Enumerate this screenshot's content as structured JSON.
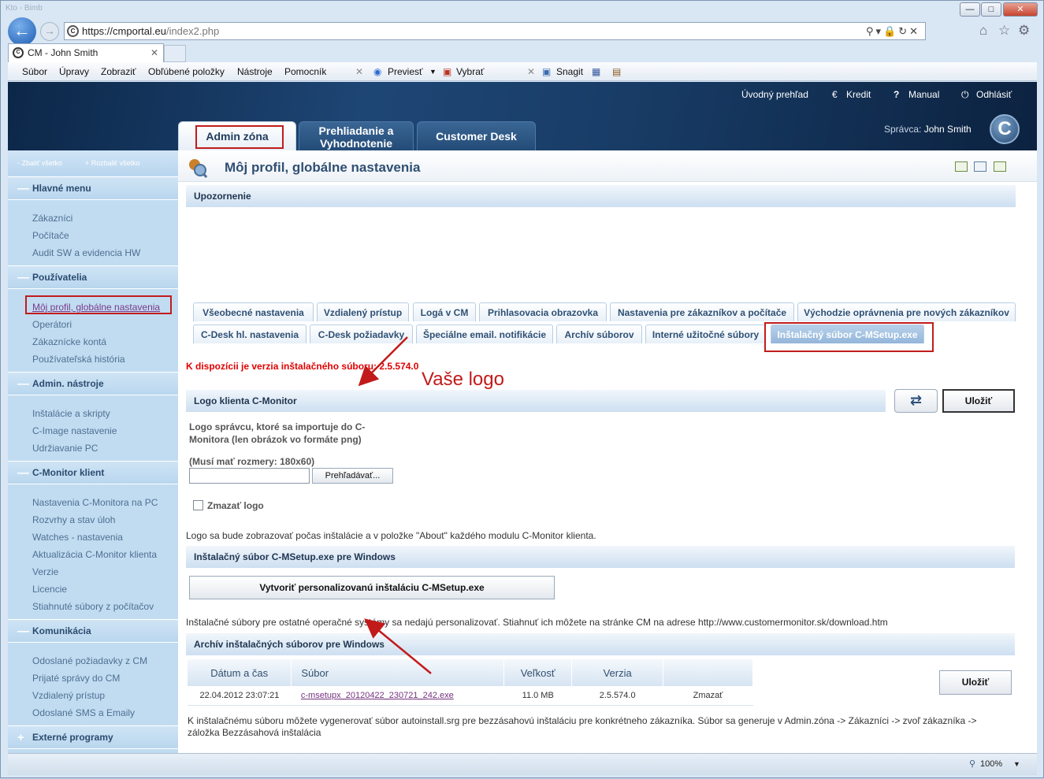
{
  "browser": {
    "title_dim": "Kto - Bimb",
    "url_scheme": "https://",
    "url_host": "cmportal.eu",
    "url_path": "/index2.php",
    "tab_title": "CM - John Smith",
    "zoom": "100%"
  },
  "menubar": [
    "Súbor",
    "Úpravy",
    "Zobraziť",
    "Obľúbené položky",
    "Nástroje",
    "Pomocník"
  ],
  "toolbar": {
    "previest": "Previesť",
    "vybrat": "Vybrať",
    "snagit": "Snagit"
  },
  "toplinks": {
    "overview": "Úvodný prehľad",
    "credit": "Kredit",
    "manual": "Manual",
    "logout": "Odhlásiť"
  },
  "maintabs": [
    "Admin zóna",
    "Prehliadanie a\nVyhodnotenie",
    "Customer Desk"
  ],
  "spravca": {
    "label": "Správca:",
    "name": "John Smith"
  },
  "sidebar": {
    "collapse": "- Zbaliť všetko",
    "expand": "+ Rozbaliť všetko",
    "sections": [
      {
        "title": "Hlavné menu",
        "items": [
          "Zákazníci",
          "Počítače",
          "Audit SW a evidencia HW"
        ]
      },
      {
        "title": "Používatelia",
        "items": [
          "Môj profil, globálne nastavenia",
          "Operátori",
          "Zákaznícke kontá",
          "Používateľská história"
        ]
      },
      {
        "title": "Admin. nástroje",
        "items": [
          "Inštalácie a skripty",
          "C-Image nastavenie",
          "Udržiavanie PC"
        ]
      },
      {
        "title": "C-Monitor klient",
        "items": [
          "Nastavenia C-Monitora na PC",
          "Rozvrhy a stav úloh",
          "Watches - nastavenia",
          "Aktualizácia C-Monitor klienta",
          "Verzie",
          "Licencie",
          "Stiahnuté súbory z počítačov"
        ]
      },
      {
        "title": "Komunikácia",
        "items": [
          "Odoslané požiadavky z CM",
          "Prijaté správy do CM",
          "Vzdialený prístup",
          "Odoslané SMS a Emaily"
        ]
      },
      {
        "title": "Externé programy",
        "items": []
      }
    ]
  },
  "page": {
    "title": "Môj profil, globálne nastavenia",
    "warning": "Upozornenie",
    "subtabs_row1": [
      "Všeobecné nastavenia",
      "Vzdialený prístup",
      "Logá v CM",
      "Prihlasovacia obrazovka",
      "Nastavenia pre zákazníkov a počítače",
      "Východzie oprávnenia pre nových zákazníkov"
    ],
    "subtabs_row2": [
      "C-Desk hl. nastavenia",
      "C-Desk požiadavky",
      "Špeciálne email. notifikácie",
      "Archív súborov",
      "Interné užitočné súbory",
      "Inštalačný súbor C-MSetup.exe"
    ],
    "version_note": "K dispozícii je verzia inštalačného súboru: 2.5.574.0",
    "logo_section": "Logo klienta C-Monitor",
    "save": "Uložiť",
    "logo_desc": "Logo správcu, ktoré sa importuje do C-Monitora (len obrázok vo formáte png)",
    "logo_size": "(Musí mať rozmery: 180x60)",
    "browse": "Prehľadávať...",
    "delete_logo": "Zmazať logo",
    "logo_info": "Logo sa bude zobrazovať počas inštalácie a v položke \"About\" každého modulu C-Monitor klienta.",
    "setup_section": "Inštalačný súbor C-MSetup.exe pre Windows",
    "create_btn": "Vytvoriť personalizovanú inštaláciu C-MSetup.exe",
    "other_os": "Inštalačné súbory pre ostatné operačné systémy sa nedajú personalizovať. Stiahnuť ich môžete na stránke CM na adrese http://www.customermonitor.sk/download.htm",
    "archive_section": "Archív inštalačných súborov pre Windows",
    "archive_headers": [
      "Dátum a čas",
      "Súbor",
      "Veľkosť",
      "Verzia",
      ""
    ],
    "archive_rows": [
      [
        "22.04.2012 23:07:21",
        "c-msetupx_20120422_230721_242.exe",
        "11.0 MB",
        "2.5.574.0",
        "Zmazať"
      ]
    ],
    "autoinstall_note": "K inštalačnému súboru môžete vygenerovať súbor autoinstall.srg pre bezzásahovú inštaláciu pre konkrétneho zákazníka. Súbor sa generuje v Admin.zóna -> Zákazníci -> zvoľ zákazníka -> záložka Bezzásahová inštalácia",
    "annotation": "Vaše logo"
  },
  "colors": {
    "accent": "#304f72",
    "warning_red": "#e00000",
    "highlight": "#c11c1c",
    "sidebar_bg": "#c1dcf1"
  }
}
